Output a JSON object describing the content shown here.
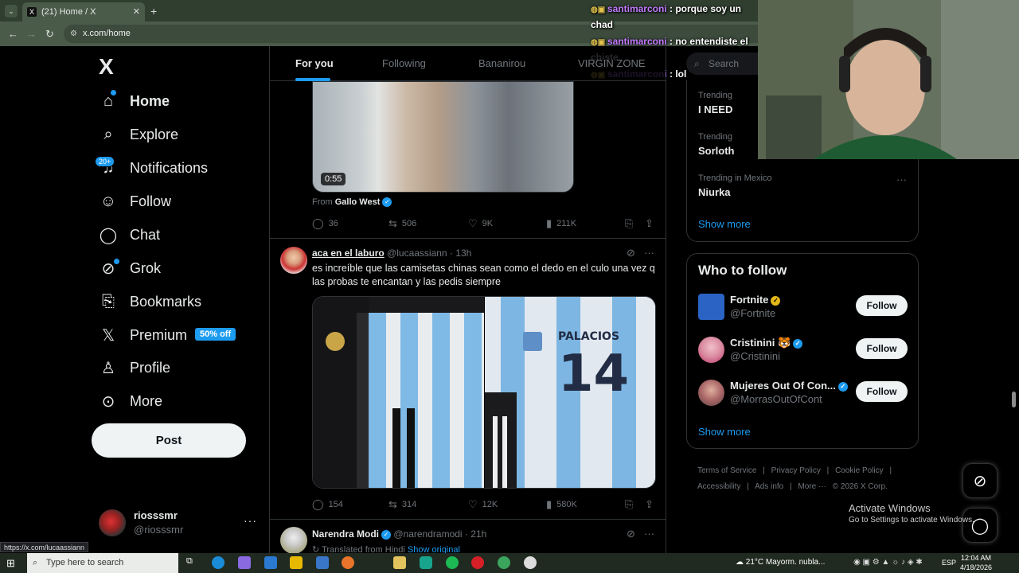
{
  "browser": {
    "tab_title": "(21) Home / X",
    "tab_favicon": "X",
    "url": "x.com/home",
    "status_url": "https://x.com/lucaassiann"
  },
  "sidebar": {
    "logo": "X",
    "items": [
      {
        "label": "Home",
        "icon": "home-icon"
      },
      {
        "label": "Explore",
        "icon": "search-icon"
      },
      {
        "label": "Notifications",
        "icon": "bell-icon",
        "badge": "20+"
      },
      {
        "label": "Follow",
        "icon": "person-add-icon"
      },
      {
        "label": "Chat",
        "icon": "chat-icon"
      },
      {
        "label": "Grok",
        "icon": "grok-icon"
      },
      {
        "label": "Bookmarks",
        "icon": "bookmark-icon"
      },
      {
        "label": "Premium",
        "icon": "x-icon",
        "badge": "50% off"
      },
      {
        "label": "Profile",
        "icon": "person-icon"
      },
      {
        "label": "More",
        "icon": "more-circle-icon"
      }
    ],
    "post_label": "Post",
    "account": {
      "name": "riosssmr",
      "handle": "@riosssmr"
    }
  },
  "feed": {
    "tabs": [
      "For you",
      "Following",
      "Bananirou",
      "VIRGIN ZONE"
    ],
    "video_duration": "0:55",
    "from_prefix": "From",
    "from_name": "Gallo West",
    "tweet1_stats": {
      "replies": "36",
      "reposts": "506",
      "likes": "9K",
      "views": "211K"
    },
    "tweet2": {
      "name": "aca en el laburo",
      "handle": "@lucaassiann",
      "time": "· 13h",
      "text": "es increíble que las camisetas chinas sean como el dedo en el culo una vez q las probas te encantan y las pedis siempre",
      "stats": {
        "replies": "154",
        "reposts": "314",
        "likes": "12K",
        "views": "580K"
      },
      "jersey_number": "14",
      "jersey_name": "PALACIOS"
    },
    "tweet3": {
      "name": "Narendra Modi",
      "handle": "@narendramodi",
      "time": "· 21h",
      "translated": "Translated from Hindi",
      "show_original": "Show original"
    }
  },
  "right": {
    "search_placeholder": "Search",
    "trends": [
      {
        "category": "Trending",
        "title": "I NEED"
      },
      {
        "category": "Trending",
        "title": "Sorloth"
      },
      {
        "category": "Trending in Mexico",
        "title": "Niurka"
      }
    ],
    "show_more": "Show more",
    "who_to_follow_title": "Who to follow",
    "who_to_follow": [
      {
        "name": "Fortnite",
        "handle": "@Fortnite",
        "button": "Follow"
      },
      {
        "name": "Cristinini 🐯",
        "handle": "@Cristinini",
        "button": "Follow"
      },
      {
        "name": "Mujeres Out Of Con...",
        "handle": "@MorrasOutOfCont",
        "button": "Follow"
      }
    ],
    "footer": [
      "Terms of Service",
      "|",
      "Privacy Policy",
      "|",
      "Cookie Policy",
      "|",
      "Accessibility",
      "|",
      "Ads info",
      "|",
      "More ···",
      "© 2026 X Corp."
    ]
  },
  "stream_chat": [
    {
      "user": "santimarconi",
      "message": ": porque soy un chad"
    },
    {
      "user": "santimarconi",
      "message": ": no entendiste el chiste"
    },
    {
      "user": "santimarconi",
      "message": ": lol"
    }
  ],
  "windows_watermark": {
    "line1": "Activate Windows",
    "line2": "Go to Settings to activate Windows."
  },
  "taskbar": {
    "search_placeholder": "Type here to search",
    "weather": "21°C  Mayorm. nubla...",
    "lang": "ESP",
    "time": "12:04 AM",
    "date": "4/18/2026"
  },
  "colors": {
    "accent": "#1d9bf0",
    "background": "#000000",
    "chat_user": "#c27bff"
  }
}
